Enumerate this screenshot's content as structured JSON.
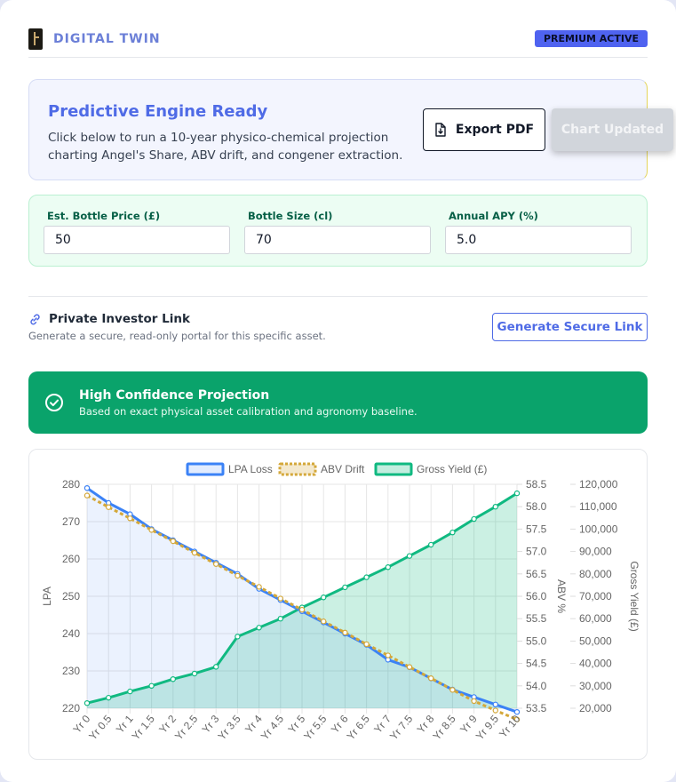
{
  "header": {
    "brand": "DIGITAL TWIN",
    "badge": "PREMIUM ACTIVE"
  },
  "engine": {
    "title": "Predictive Engine Ready",
    "description": "Click below to run a 10-year physico-chemical projection charting Angel's Share, ABV drift, and congener extraction.",
    "export_label": "Export PDF",
    "updated_label": "Chart Updated"
  },
  "inputs": {
    "price_label": "Est. Bottle Price (£)",
    "price_value": "50",
    "size_label": "Bottle Size (cl)",
    "size_value": "70",
    "apy_label": "Annual APY (%)",
    "apy_value": "5.0"
  },
  "investor": {
    "title": "Private Investor Link",
    "description": "Generate a secure, read-only portal for this specific asset.",
    "button_label": "Generate Secure Link"
  },
  "confidence": {
    "title": "High Confidence Projection",
    "description": "Based on exact physical asset calibration and agronomy baseline."
  },
  "colors": {
    "lpa": "#3b82f6",
    "abv": "#d4a83a",
    "yield": "#10b981",
    "accent": "#4f6be6",
    "success": "#0aa36b"
  },
  "chart_data": {
    "type": "line",
    "title": "",
    "x": [
      "Yr 0",
      "Yr 0.5",
      "Yr 1",
      "Yr 1.5",
      "Yr 2",
      "Yr 2.5",
      "Yr 3",
      "Yr 3.5",
      "Yr 4",
      "Yr 4.5",
      "Yr 5",
      "Yr 5.5",
      "Yr 6",
      "Yr 6.5",
      "Yr 7",
      "Yr 7.5",
      "Yr 8",
      "Yr 8.5",
      "Yr 9",
      "Yr 9.5",
      "Yr 10"
    ],
    "axes": {
      "left": {
        "label": "LPA",
        "ylim": [
          220,
          280
        ],
        "ticks": [
          220,
          230,
          240,
          250,
          260,
          270,
          280
        ]
      },
      "mid": {
        "label": "ABV %",
        "ylim": [
          53.5,
          58.5
        ],
        "ticks": [
          "53.5",
          "54.0",
          "54.5",
          "55.0",
          "55.5",
          "56.0",
          "56.5",
          "57.0",
          "57.5",
          "58.0",
          "58.5"
        ]
      },
      "right": {
        "label": "Gross Yield (£)",
        "ylim": [
          20000,
          120000
        ],
        "ticks": [
          "20,000",
          "30,000",
          "40,000",
          "50,000",
          "60,000",
          "70,000",
          "80,000",
          "90,000",
          "100,000",
          "110,000",
          "120,000"
        ]
      }
    },
    "legend_position": "top",
    "grid": true,
    "series": [
      {
        "name": "LPA Loss",
        "axis": "left",
        "values": [
          279,
          275,
          272,
          268,
          265,
          262,
          259,
          256,
          252,
          249,
          246,
          243,
          240,
          237,
          233,
          231,
          228,
          225,
          223,
          221,
          219
        ]
      },
      {
        "name": "ABV Drift",
        "axis": "mid",
        "values": [
          58.25,
          57.99,
          57.74,
          57.48,
          57.23,
          56.97,
          56.72,
          56.46,
          56.21,
          55.95,
          55.7,
          55.44,
          55.19,
          54.93,
          54.68,
          54.42,
          54.17,
          53.91,
          53.66,
          53.45,
          53.25
        ]
      },
      {
        "name": "Gross Yield (£)",
        "axis": "right",
        "values": [
          22300,
          24700,
          27500,
          30000,
          33000,
          35500,
          38500,
          52000,
          56000,
          60000,
          65000,
          69500,
          74000,
          78500,
          83000,
          88000,
          93000,
          98500,
          104500,
          110000,
          116000
        ]
      }
    ]
  }
}
